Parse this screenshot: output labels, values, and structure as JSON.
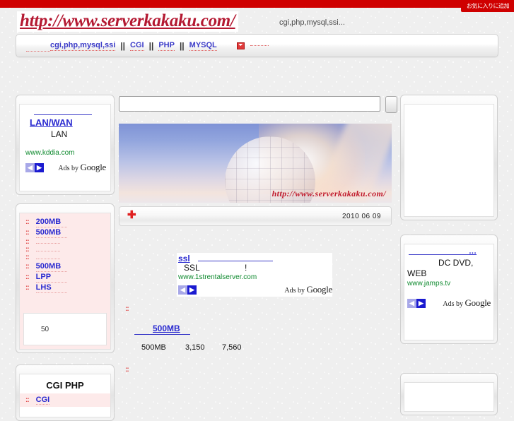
{
  "topbar": {
    "favorite_button": "お気に入りに追加"
  },
  "header": {
    "logo": "http://www.serverkakaku.com/",
    "tagline": "cgi,php,mysql,ssi..."
  },
  "nav": {
    "items": [
      {
        "label": "cgi,php,mysql,ssi"
      },
      {
        "label": "CGI"
      },
      {
        "label": "PHP"
      },
      {
        "label": "MYSQL"
      }
    ],
    "separator": "||",
    "mail_icon": "mail-icon"
  },
  "search": {
    "value": "",
    "placeholder": "",
    "button_label": ""
  },
  "banner": {
    "url_overlay": "http://www.serverkakaku.com/"
  },
  "datebar": {
    "plus_icon": "plus-icon",
    "date": "2010 06 09"
  },
  "ads": {
    "left": {
      "headline": "LAN/WAN",
      "line1": "LAN",
      "url": "www.kddia.com",
      "prev": "◀",
      "next": "▶",
      "ads_by": "Ads by ",
      "google": "Google"
    },
    "center": {
      "headline": "ssl",
      "line1": "SSL",
      "exclaim": "!",
      "url": "www.1strentalserver.com",
      "prev": "◀",
      "next": "▶",
      "ads_by": "Ads by ",
      "google": "Google"
    },
    "right": {
      "headline_dots": "...",
      "line1": "DC DVD,",
      "line2": "WEB",
      "url": "www.jamps.tv",
      "prev": "◀",
      "next": "▶",
      "ads_by": "Ads by ",
      "google": "Google"
    }
  },
  "sidebar": {
    "list_items": [
      {
        "label": "200MB",
        "blank": false
      },
      {
        "label": "500MB",
        "blank": false
      },
      {
        "label": "",
        "blank": true
      },
      {
        "label": "",
        "blank": true
      },
      {
        "label": "",
        "blank": true
      },
      {
        "label": "500MB",
        "blank": false
      },
      {
        "label": "LPP",
        "blank": false
      },
      {
        "label": "LHS",
        "blank": false
      }
    ],
    "bullet": "::",
    "counter": "50",
    "cgiphp": {
      "title": "CGI PHP",
      "first_item": "CGI"
    }
  },
  "main": {
    "price_heading": "500MB",
    "price_bullet": "::",
    "bottom_bullet": "::",
    "price_row": {
      "size": "500MB",
      "value_a": "3,150",
      "value_b": "7,560"
    }
  },
  "colors": {
    "brand_red": "#cf0000",
    "logo_red": "#b41932",
    "link_blue": "#2a2ad0",
    "ad_url_green": "#0f8a2f",
    "pink_panel": "#fdeaea"
  }
}
